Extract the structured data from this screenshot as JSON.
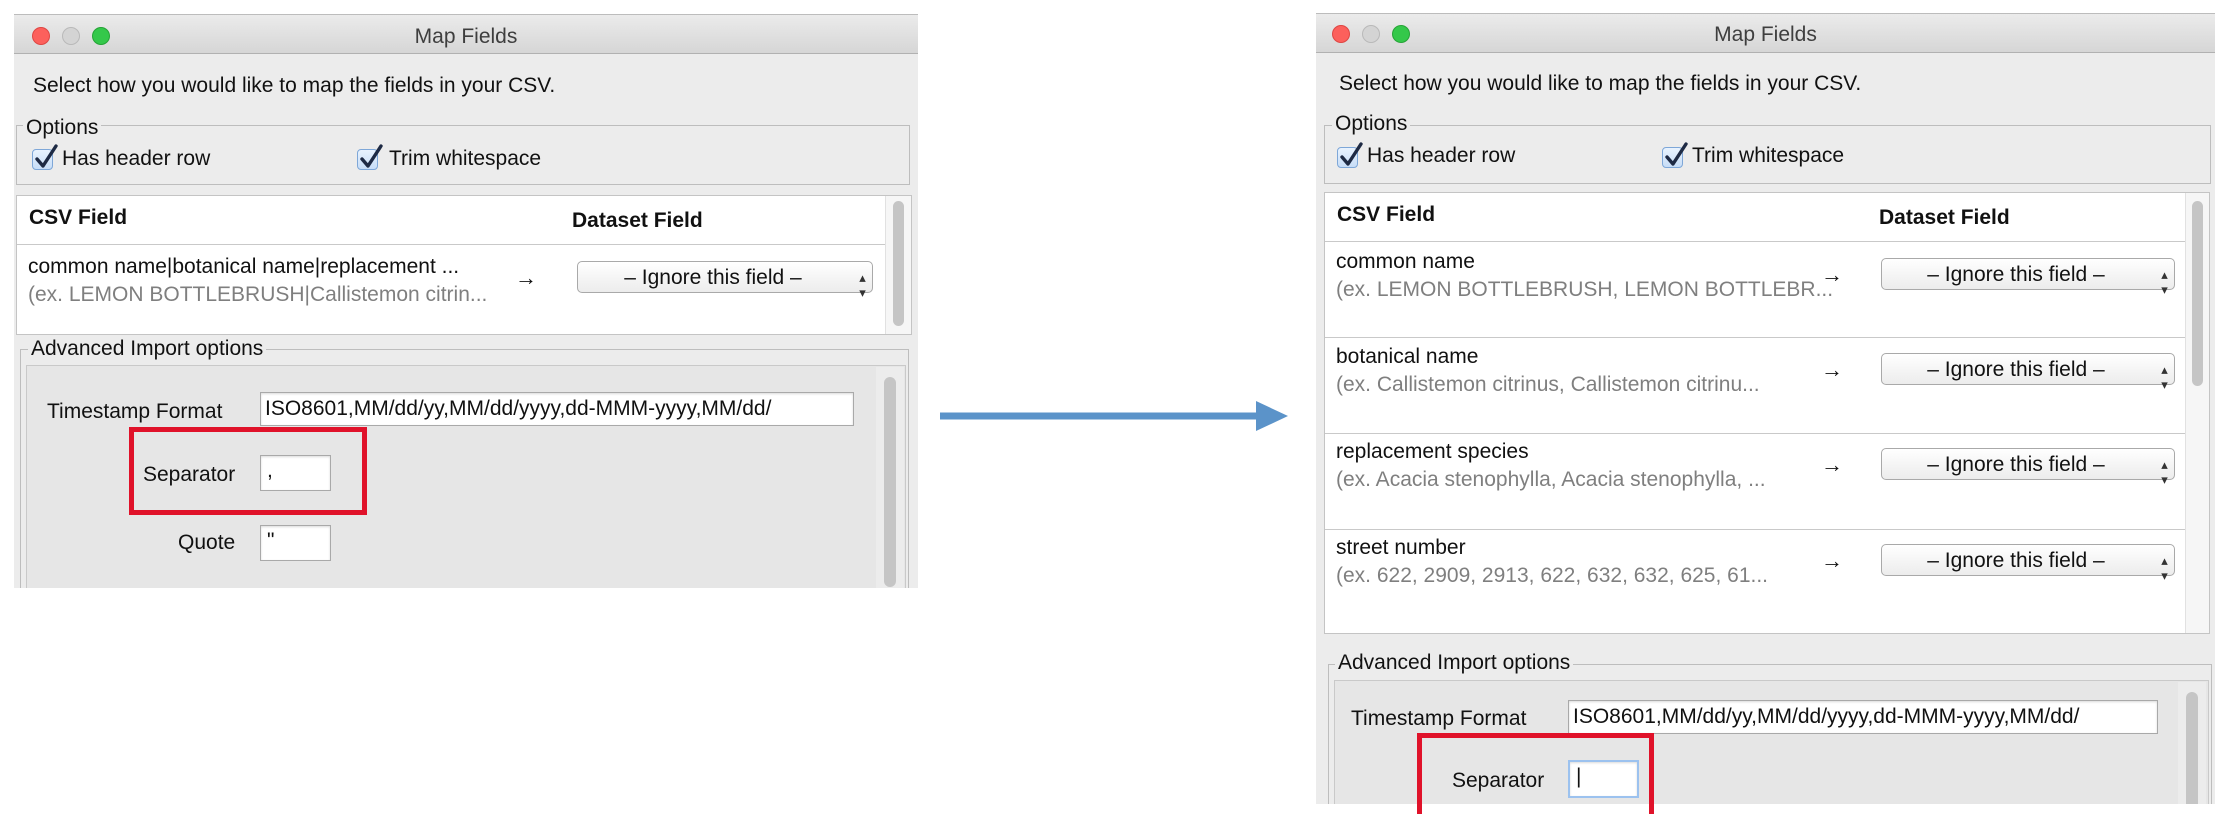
{
  "dialog": {
    "title": "Map Fields",
    "instruction": "Select how you would like to map the fields in your CSV.",
    "options_legend": "Options",
    "has_header_label": "Has header row",
    "trim_whitespace_label": "Trim whitespace",
    "has_header_checked": true,
    "trim_whitespace_checked": true,
    "col_csv": "CSV Field",
    "col_dataset": "Dataset Field",
    "ignore_label": "– Ignore this field –",
    "advanced_legend": "Advanced Import options",
    "timestamp_label": "Timestamp Format",
    "timestamp_value": "ISO8601,MM/dd/yy,MM/dd/yyyy,dd-MMM-yyyy,MM/dd/",
    "separator_label": "Separator",
    "quote_label": "Quote"
  },
  "before": {
    "rows": [
      {
        "name": "common name|botanical name|replacement ...",
        "example": "(ex. LEMON BOTTLEBRUSH|Callistemon citrin..."
      }
    ],
    "separator_value": ",",
    "quote_value": "\""
  },
  "after": {
    "rows": [
      {
        "name": "common name",
        "example": "(ex. LEMON BOTTLEBRUSH, LEMON BOTTLEBR..."
      },
      {
        "name": "botanical name",
        "example": "(ex. Callistemon citrinus, Callistemon citrinu..."
      },
      {
        "name": "replacement species",
        "example": "(ex. Acacia stenophylla, Acacia stenophylla, ..."
      },
      {
        "name": "street number",
        "example": "(ex. 622, 2909, 2913, 622, 632, 632, 625, 61..."
      }
    ],
    "separator_value": "|"
  },
  "glyphs": {
    "row_arrow": "→",
    "popup_arrows": "▴▾"
  },
  "colors": {
    "highlight_box": "#e0122a",
    "transition_arrow": "#5b93c9",
    "traffic_close": "#fc605c",
    "traffic_zoom": "#34c84a"
  }
}
